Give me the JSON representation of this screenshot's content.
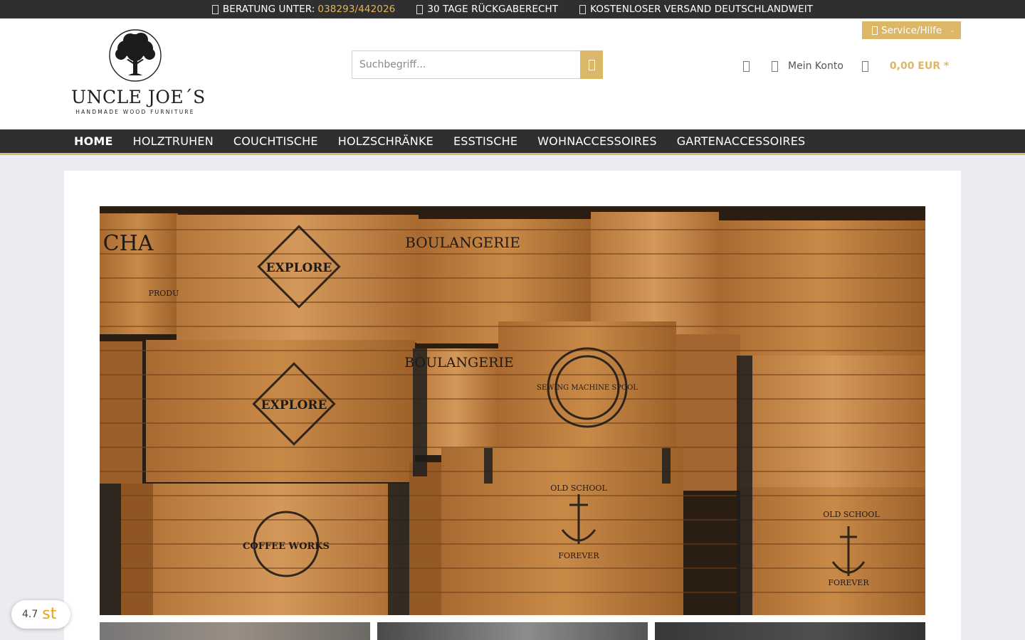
{
  "topbar": {
    "items": [
      {
        "label": "BERATUNG UNTER:",
        "phone": "038293/442026"
      },
      {
        "label": "30 TAGE RÜCKGABERECHT"
      },
      {
        "label": "KOSTENLOSER VERSAND DEUTSCHLANDWEIT"
      }
    ]
  },
  "header": {
    "logo": {
      "brand": "UNCLE JOE´S",
      "tagline": "HANDMADE WOOD FURNITURE"
    },
    "service_label": "Service/Hilfe",
    "search_placeholder": "Suchbegriff...",
    "account_label": "Mein Konto",
    "cart_amount": "0,00 EUR *"
  },
  "nav": {
    "items": [
      "HOME",
      "HOLZTRUHEN",
      "COUCHTISCHE",
      "HOLZSCHRÄNKE",
      "ESSTISCHE",
      "WOHNACCESSOIRES",
      "GARTENACCESSOIRES"
    ]
  },
  "hero": {
    "crate_labels": [
      "EXPLORE",
      "BOULANGERIE",
      "COFFEE WORKS",
      "SEWING MACHINE SPOOL",
      "OLD SCHOOL",
      "FOREVER",
      "CHA",
      "PRODU"
    ]
  },
  "rating": {
    "score": "4.7",
    "stars": "st"
  },
  "colors": {
    "accent": "#dcb767",
    "dark": "#2f2f2f",
    "phone": "#e3b55a"
  }
}
